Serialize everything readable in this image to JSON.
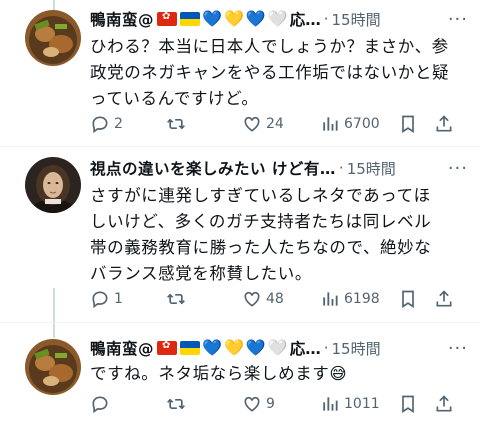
{
  "tweets": [
    {
      "name": "鴨南蛮@",
      "flags": [
        "hk",
        "ua"
      ],
      "hearts": [
        "💙",
        "💛",
        "💙",
        "🤍"
      ],
      "name_suffix": "応…",
      "separator": "·",
      "time": "15時間",
      "text": "ひわる？本当に日本人でしょうか？まさか、参\n政党のネガキャンをやる工作垢ではないかと疑\nっているんですけど。",
      "reply_count": "2",
      "retweet_count": "",
      "like_count": "24",
      "view_count": "6700"
    },
    {
      "name": "視点の違いを楽しみたい けど有…",
      "flags": [],
      "hearts": [],
      "name_suffix": "",
      "separator": "·",
      "time": "15時間",
      "text": "さすがに連発しすぎているしネタであってほ\nしいけど、多くのガチ支持者たちは同レベル\n帯の義務教育に勝った人たちなので、絶妙な\nバランス感覚を称賛したい。",
      "reply_count": "1",
      "retweet_count": "",
      "like_count": "48",
      "view_count": "6198"
    },
    {
      "name": "鴨南蛮@",
      "flags": [
        "hk",
        "ua"
      ],
      "hearts": [
        "💙",
        "💛",
        "💙",
        "🤍"
      ],
      "name_suffix": "応…",
      "separator": "·",
      "time": "15時間",
      "text": "ですね。ネタ垢なら楽しめます😅",
      "reply_count": "",
      "retweet_count": "",
      "like_count": "9",
      "view_count": "1011"
    }
  ],
  "icons": [
    "reply-icon",
    "retweet-icon",
    "like-icon",
    "views-icon",
    "bookmark-icon",
    "share-icon",
    "more-icon"
  ],
  "colors": {
    "meta": "#536471",
    "divider": "#eff3f4",
    "thread": "#cfd9de"
  }
}
